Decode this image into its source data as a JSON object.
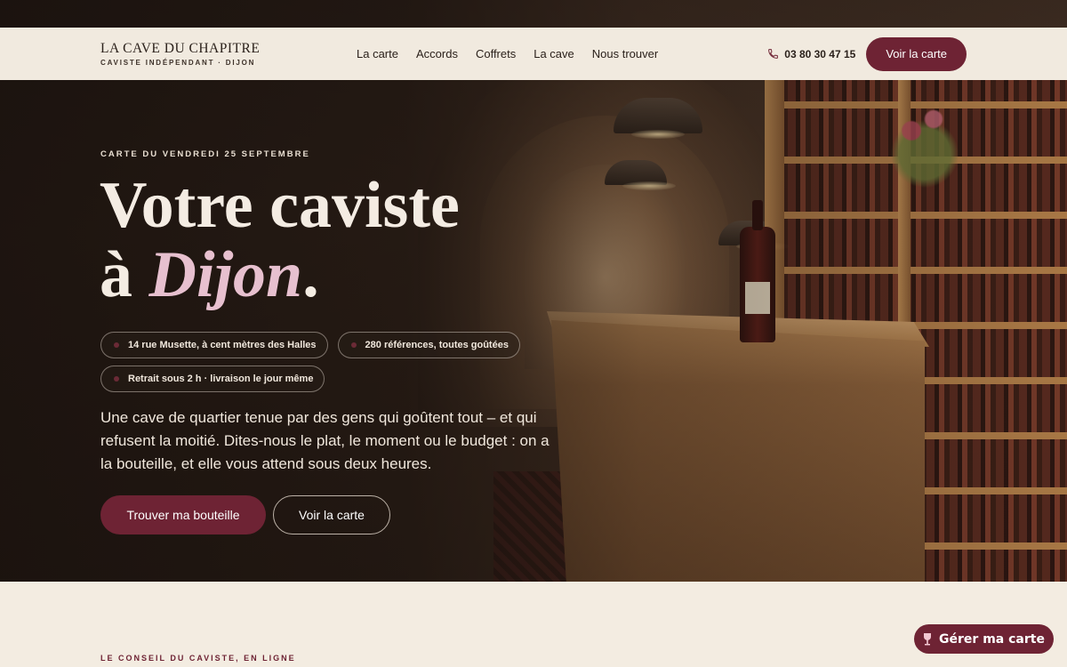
{
  "header": {
    "brand_name": "LA CAVE DU CHAPITRE",
    "brand_tagline": "CAVISTE INDÉPENDANT · DIJON",
    "nav": [
      "La carte",
      "Accords",
      "Coffrets",
      "La cave",
      "Nous trouver"
    ],
    "phone": "03 80 30 47 15",
    "cta_label": "Voir la carte"
  },
  "hero": {
    "eyebrow": "CARTE DU VENDREDI 25 SEPTEMBRE",
    "title_line1": "Votre caviste",
    "title_prefix": "à ",
    "title_accent": "Dijon",
    "title_period": ".",
    "chips": [
      "14 rue Musette, à cent mètres des Halles",
      "280 références, toutes goûtées",
      "Retrait sous 2 h · livraison le jour même"
    ],
    "lede": "Une cave de quartier tenue par des gens qui goûtent tout – et qui refusent la moitié. Dites-nous le plat, le moment ou le budget : on a la bouteille, et elle vous attend sous deux heures.",
    "primary_button": "Trouver ma bouteille",
    "secondary_button": "Voir la carte"
  },
  "next_section": {
    "eyebrow": "LE CONSEIL DU CAVISTE, EN LIGNE"
  },
  "floating_button": {
    "label": "Gérer ma carte",
    "icon": "wine-glass-icon"
  },
  "colors": {
    "accent": "#6e2334",
    "header_bg": "#f1eadf",
    "page_bg": "#f3ece1",
    "title_accent": "#e7c0cf"
  }
}
